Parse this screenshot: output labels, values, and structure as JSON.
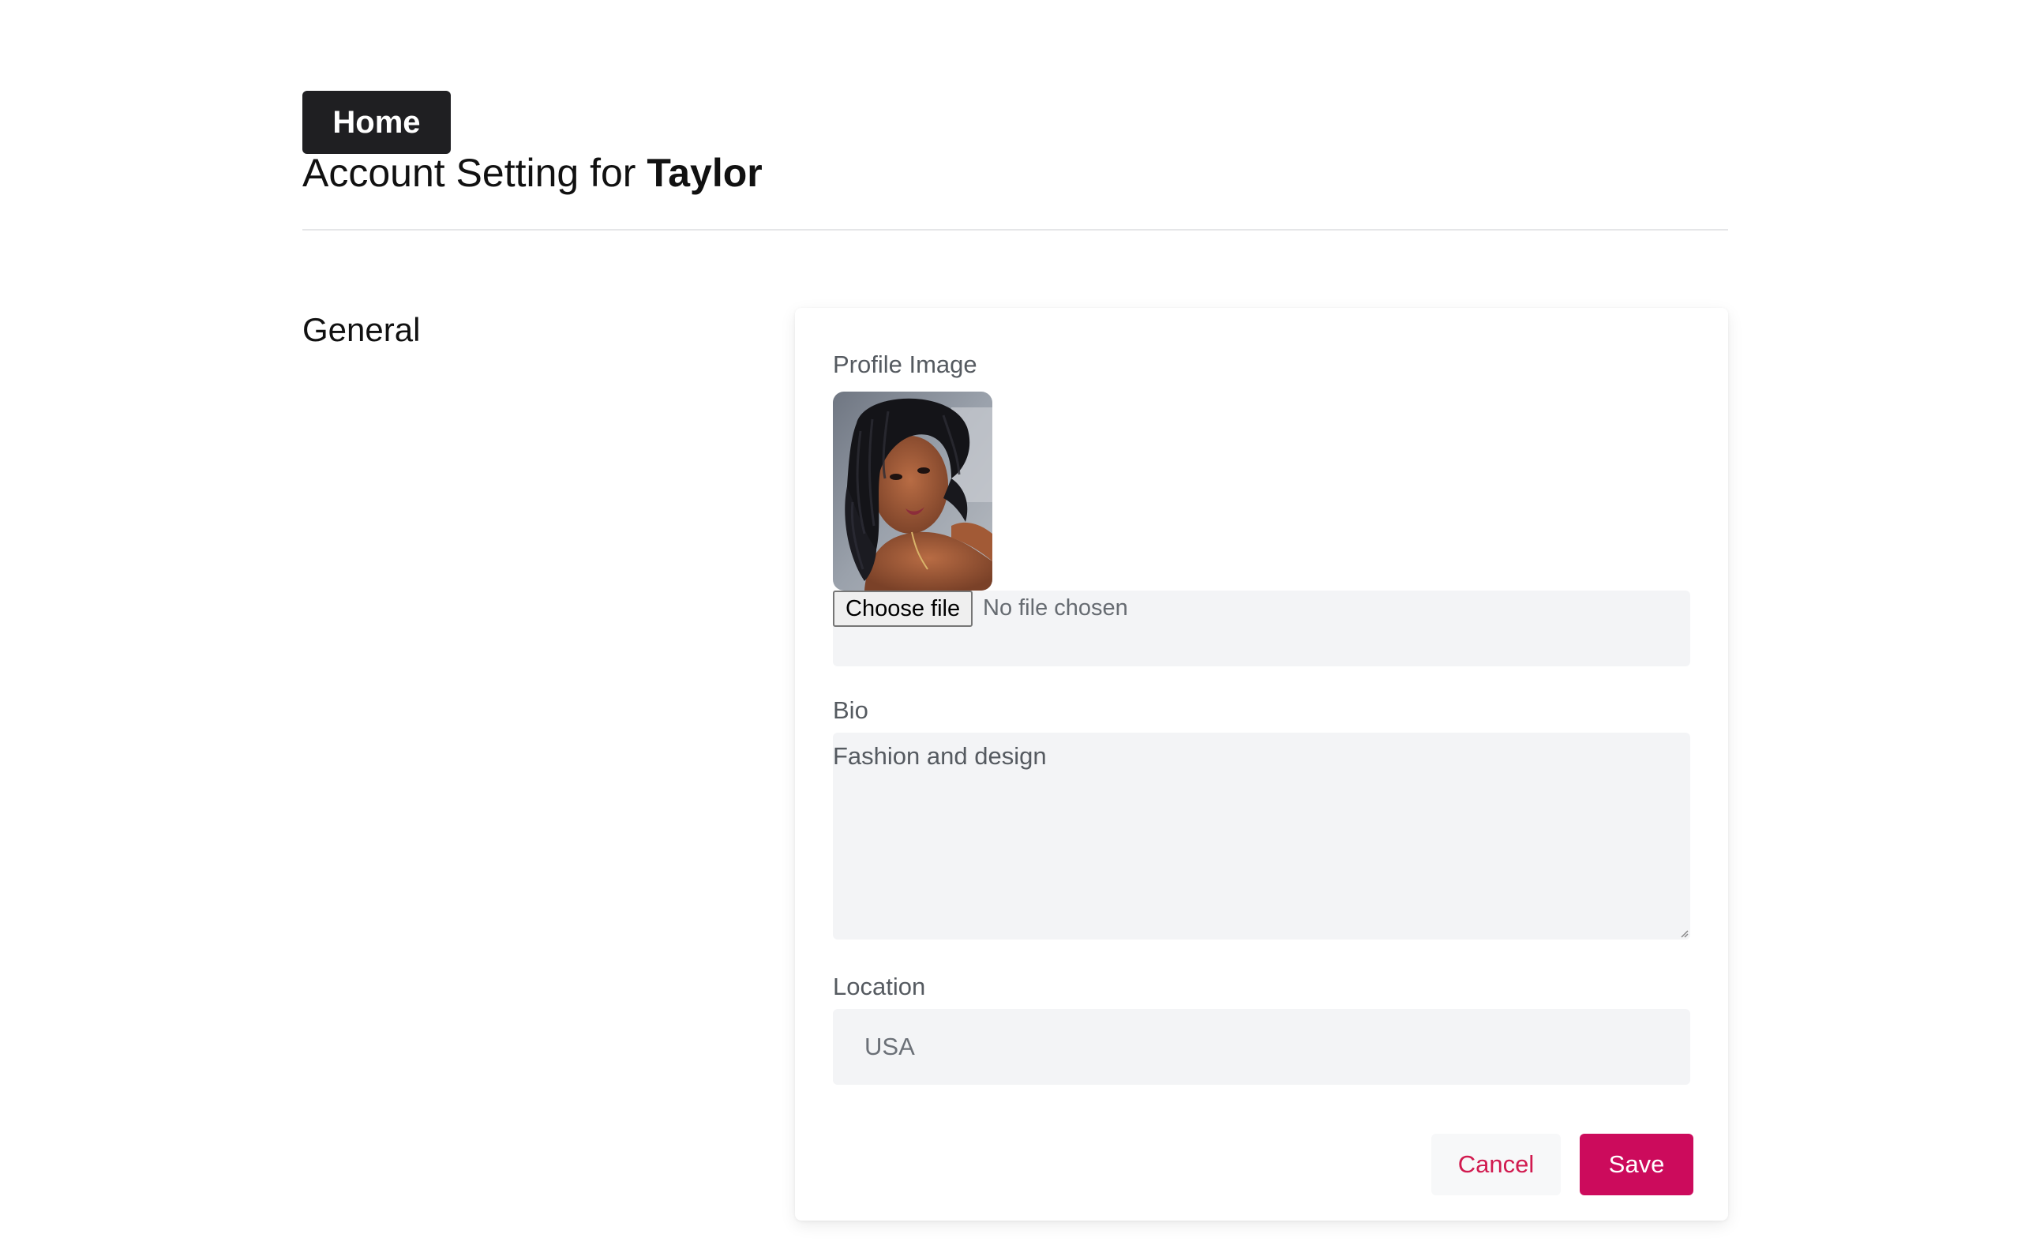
{
  "nav": {
    "home_label": "Home"
  },
  "header": {
    "title_prefix": "Account Setting for",
    "user_name": "Taylor"
  },
  "section": {
    "title": "General"
  },
  "form": {
    "profile_image": {
      "label": "Profile Image",
      "choose_file_label": "Choose file",
      "file_status": "No file chosen"
    },
    "bio": {
      "label": "Bio",
      "value": "Fashion and design"
    },
    "location": {
      "label": "Location",
      "value": "USA"
    },
    "cancel_label": "Cancel",
    "save_label": "Save"
  },
  "colors": {
    "home_button_bg": "#1f1f22",
    "save_button_bg": "#cc0b5c",
    "cancel_text": "#d11a4f",
    "input_bg": "#f3f4f6"
  }
}
